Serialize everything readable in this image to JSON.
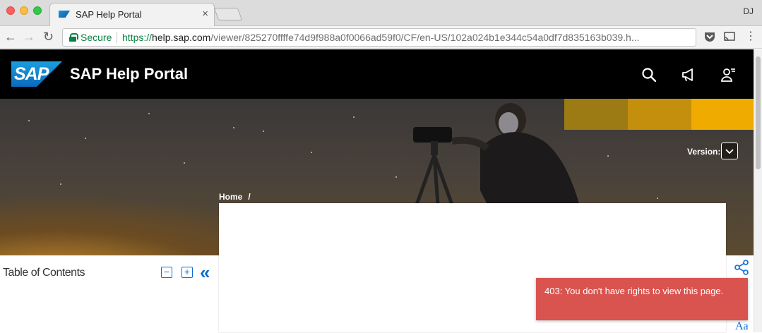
{
  "browser": {
    "tab_title": "SAP Help Portal",
    "tab_close": "×",
    "user_initials": "DJ",
    "secure_label": "Secure",
    "url_scheme": "https://",
    "url_host": "help.sap.com",
    "url_path": "/viewer/825270ffffe74d9f988a0f0066ad59f0/CF/en-US/102a024b1e344c54a0df7d835163b039.h...",
    "back": "←",
    "forward": "→",
    "reload": "↻",
    "menu": "⋮"
  },
  "header": {
    "logo_text": "SAP",
    "title": "SAP Help Portal"
  },
  "hero": {
    "version_label": "Version:",
    "breadcrumb_home": "Home",
    "breadcrumb_sep": "/"
  },
  "toc": {
    "title": "Table of Contents",
    "collapse_label": "−",
    "expand_label": "+",
    "hide_label": "«"
  },
  "sidebar_tools": {
    "font_size_label": "Aa"
  },
  "toast": {
    "message": "403: You don't have rights to view this page."
  },
  "colors": {
    "sap_blue": "#0a6ed1",
    "header_bg": "#000000",
    "toast_bg": "#d9534f",
    "accent_gold": "#f0ab00"
  }
}
